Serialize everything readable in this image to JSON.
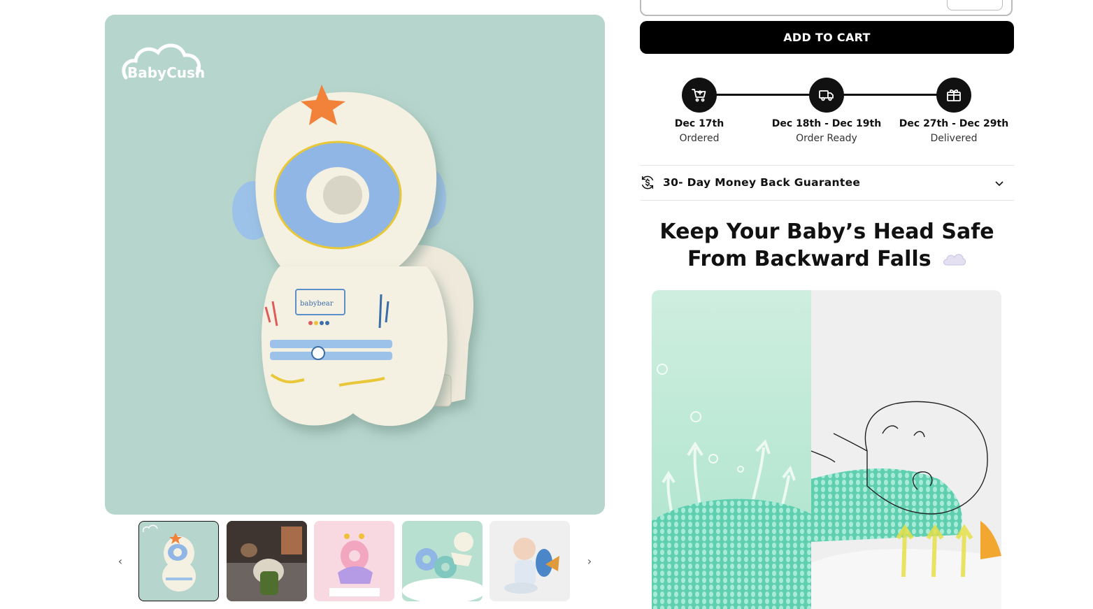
{
  "brand": {
    "logo_text": "BabyCush"
  },
  "product_patch_text": "babybear",
  "gallery": {
    "thumbnails": [
      {
        "alt": "astronaut pillow thumbnail",
        "active": true
      },
      {
        "alt": "baby in living room thumbnail",
        "active": false
      },
      {
        "alt": "pink bee pillow thumbnail",
        "active": false
      },
      {
        "alt": "angel wings pillows thumbnail",
        "active": false
      },
      {
        "alt": "baby sitting with pillow thumbnail",
        "active": false
      }
    ],
    "prev_icon": "‹",
    "next_icon": "›"
  },
  "cart": {
    "add_to_cart_label": "ADD TO CART"
  },
  "shipping_timeline": [
    {
      "date": "Dec 17th",
      "label": "Ordered",
      "icon": "cart-icon"
    },
    {
      "date": "Dec 18th - Dec 19th",
      "label": "Order Ready",
      "icon": "truck-icon"
    },
    {
      "date": "Dec 27th - Dec 29th",
      "label": "Delivered",
      "icon": "gift-icon"
    }
  ],
  "guarantee": {
    "label": "30- Day Money Back Guarantee",
    "icon": "money-back-icon"
  },
  "headline": {
    "line1": "Keep Your Baby’s Head Safe",
    "line2": "From Backward Falls"
  },
  "colors": {
    "accent": "#000000",
    "image_bg": "#b6d5cc",
    "mint": "#6fd6b8"
  }
}
